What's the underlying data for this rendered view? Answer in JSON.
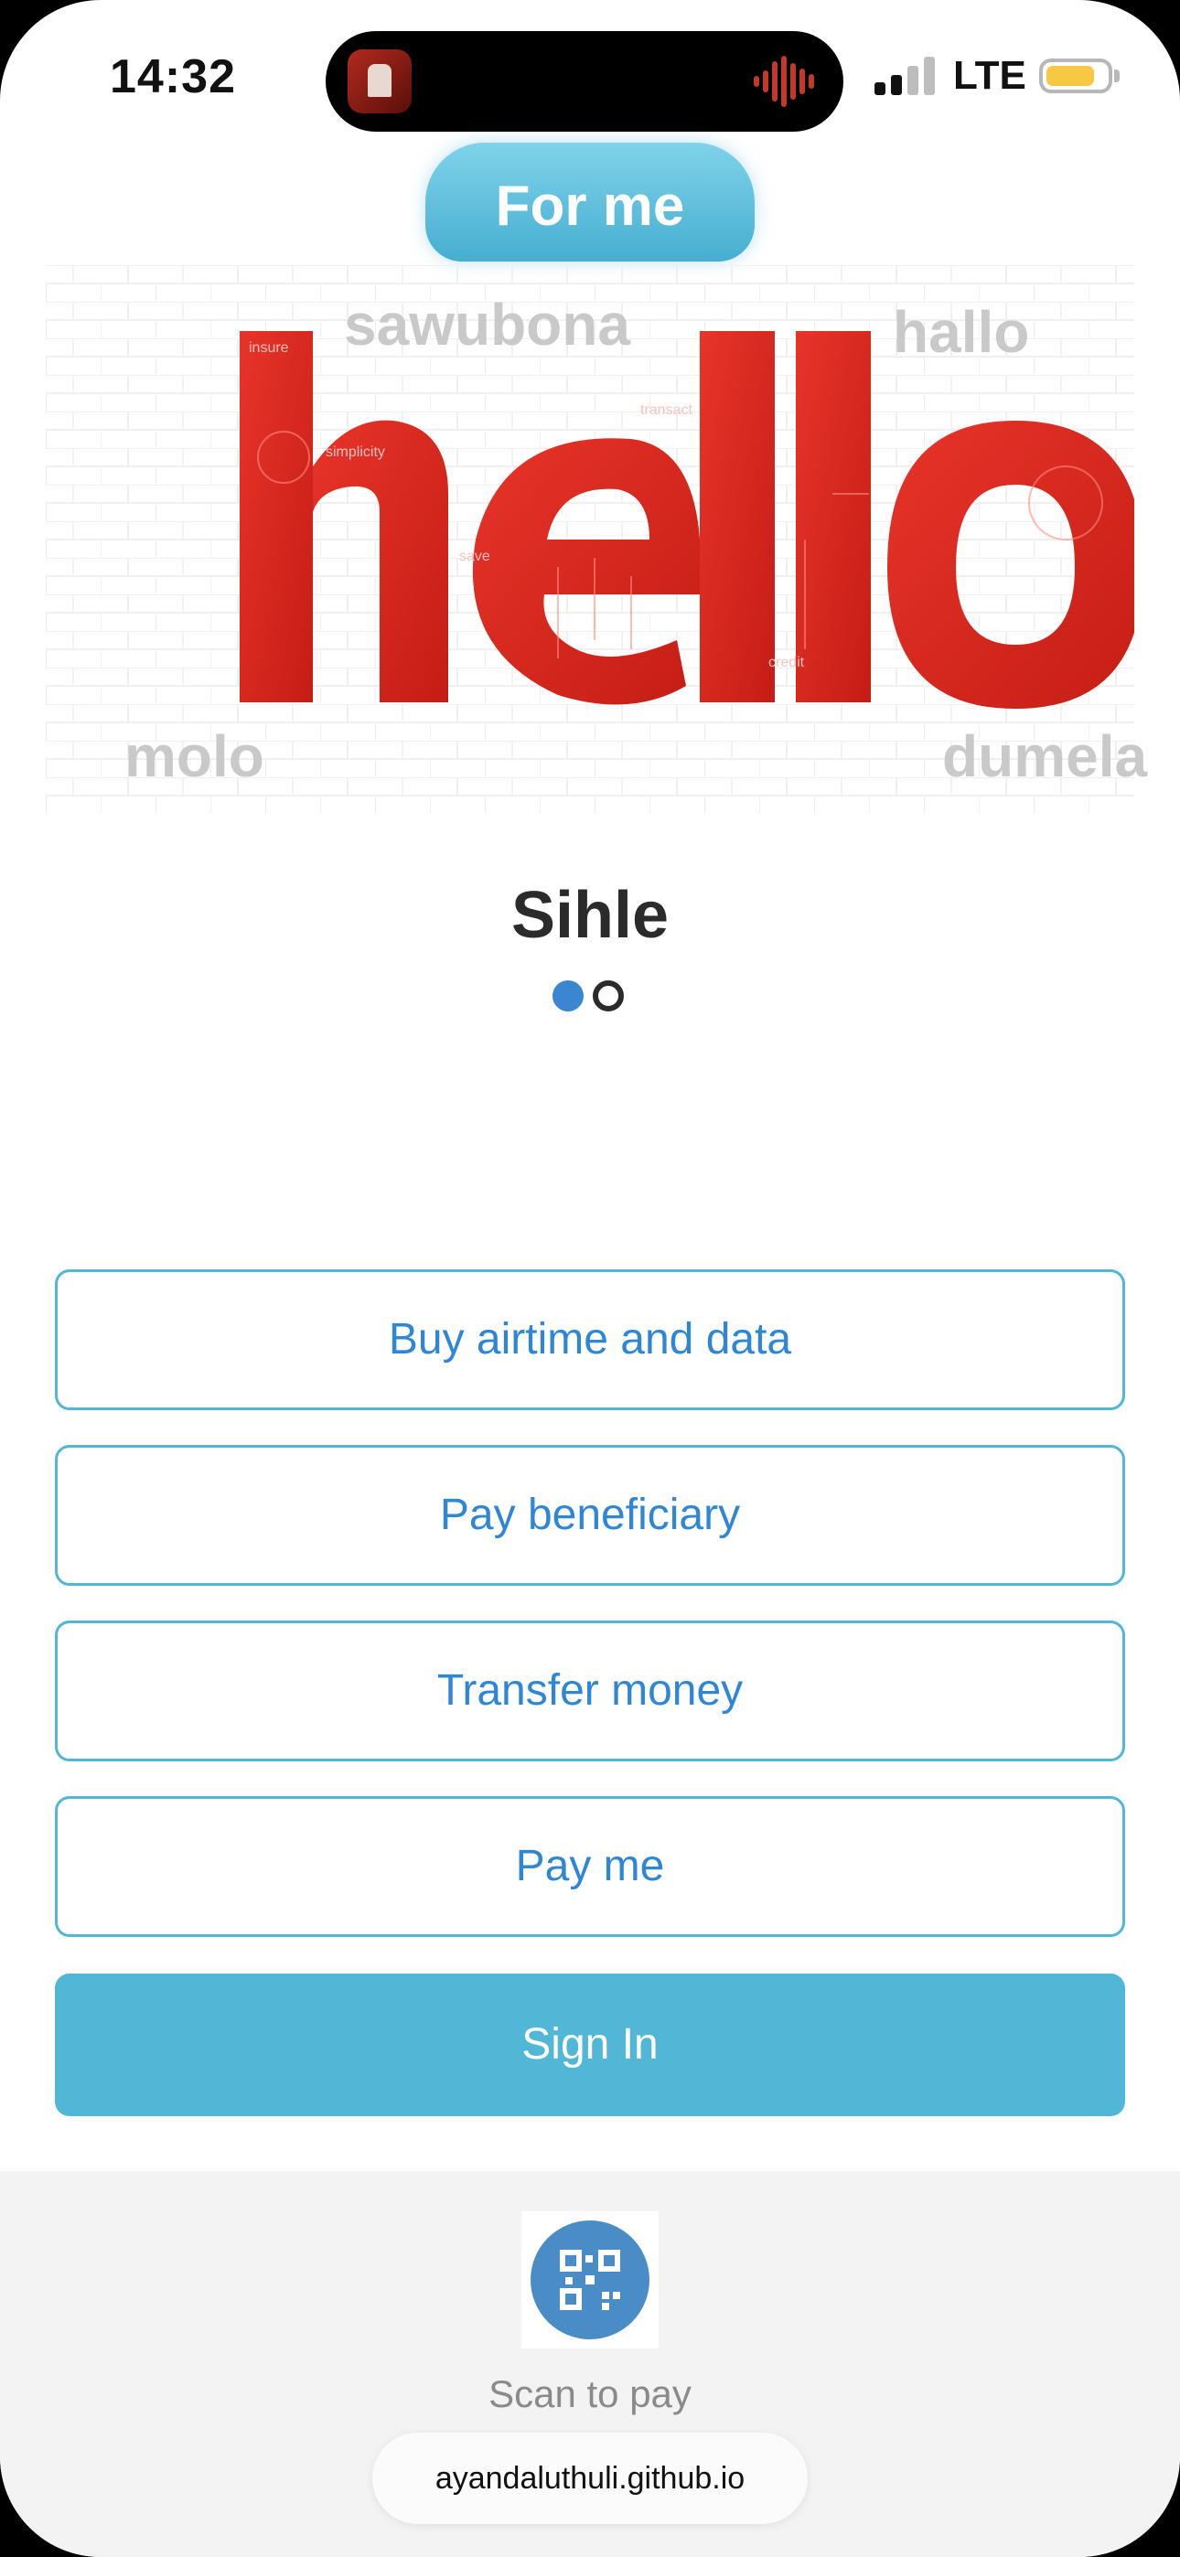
{
  "status": {
    "time": "14:32",
    "network": "LTE",
    "battery_color": "#f7c844"
  },
  "header": {
    "tab_label": "For me"
  },
  "hero": {
    "word": "hello",
    "greetings": [
      "sawubona",
      "hallo",
      "molo",
      "dumela"
    ],
    "tags": [
      "insure",
      "simplicity",
      "save",
      "transact",
      "credit"
    ],
    "accent_color": "#d9271f"
  },
  "profile": {
    "name": "Sihle",
    "pager": {
      "current": 1,
      "total": 2
    }
  },
  "actions": [
    {
      "label": "Buy airtime and data"
    },
    {
      "label": "Pay beneficiary"
    },
    {
      "label": "Transfer money"
    },
    {
      "label": "Pay me"
    }
  ],
  "sign_in": {
    "label": "Sign In",
    "color": "#52b6d6"
  },
  "footer": {
    "qr_icon": "qr-code-icon",
    "scan_label": "Scan to pay",
    "url": "ayandaluthuli.github.io"
  }
}
